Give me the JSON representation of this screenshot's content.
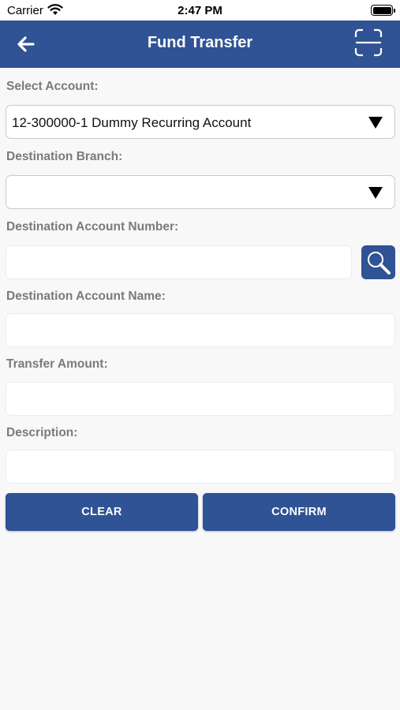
{
  "status_bar": {
    "carrier": "Carrier",
    "time": "2:47 PM"
  },
  "header": {
    "title": "Fund Transfer",
    "back_icon": "arrow-left-icon",
    "scan_icon": "scan-icon"
  },
  "form": {
    "select_account": {
      "label": "Select Account:",
      "value": "12-300000-1 Dummy Recurring Account"
    },
    "destination_branch": {
      "label": "Destination Branch:",
      "value": ""
    },
    "destination_account_number": {
      "label": "Destination Account Number:",
      "value": ""
    },
    "destination_account_name": {
      "label": "Destination Account Name:",
      "value": ""
    },
    "transfer_amount": {
      "label": "Transfer Amount:",
      "value": ""
    },
    "description": {
      "label": "Description:",
      "value": ""
    }
  },
  "buttons": {
    "clear": "CLEAR",
    "confirm": "CONFIRM"
  },
  "colors": {
    "primary": "#2f5394",
    "background": "#f8f8f8",
    "label": "#7a7a7a"
  }
}
